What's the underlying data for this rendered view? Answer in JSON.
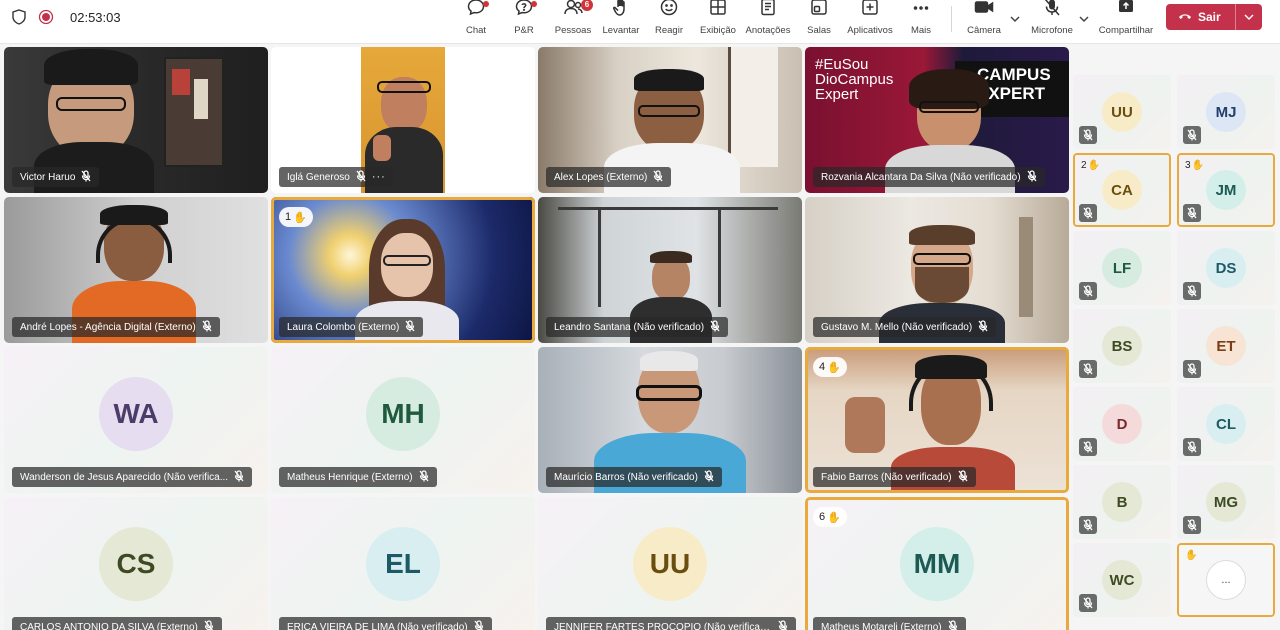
{
  "timer": "02:53:03",
  "toolbar": [
    {
      "label": "Chat",
      "icon": "chat-icon"
    },
    {
      "label": "P&R",
      "icon": "qa-icon"
    },
    {
      "label": "Pessoas",
      "icon": "people-icon",
      "badge": "6"
    },
    {
      "label": "Levantar",
      "icon": "hand-icon"
    },
    {
      "label": "Reagir",
      "icon": "emoji-icon"
    },
    {
      "label": "Exibição",
      "icon": "view-icon"
    },
    {
      "label": "Anotações",
      "icon": "notes-icon"
    },
    {
      "label": "Salas",
      "icon": "rooms-icon"
    },
    {
      "label": "Aplicativos",
      "icon": "apps-icon"
    },
    {
      "label": "Mais",
      "icon": "more-icon"
    },
    {
      "label": "Câmera",
      "icon": "camera-icon"
    },
    {
      "label": "Microfone",
      "icon": "mic-off-icon"
    },
    {
      "label": "Compartilhar",
      "icon": "share-icon"
    }
  ],
  "leave": {
    "label": "Sair"
  },
  "colors": {
    "accent": "#e8a93d",
    "leave": "#c4314b"
  },
  "tiles": [
    {
      "name": "Victor Haruo",
      "hand": null
    },
    {
      "name": "Iglá Generoso",
      "hand": null
    },
    {
      "name": "Alex Lopes (Externo)",
      "hand": null
    },
    {
      "name": "Rozvania Alcantara Da Silva (Não verificado)",
      "hand": null,
      "sign": "#EuSou DioCampus Expert",
      "banner": "CAMPUS EXPERT"
    },
    {
      "name": "André Lopes - Agência Digital (Externo)",
      "hand": null
    },
    {
      "name": "Laura Colombo (Externo)",
      "hand": "1"
    },
    {
      "name": "Leandro Santana (Não verificado)",
      "hand": null
    },
    {
      "name": "Gustavo M. Mello (Não verificado)",
      "hand": null
    },
    {
      "name": "Wanderson de Jesus Aparecido (Não verifica...",
      "hand": null,
      "initials": "WA"
    },
    {
      "name": "Matheus Henrique (Externo)",
      "hand": null,
      "initials": "MH"
    },
    {
      "name": "Maurício Barros (Não verificado)",
      "hand": null
    },
    {
      "name": "Fabio Barros (Não verificado)",
      "hand": "4"
    },
    {
      "name": "CARLOS ANTONIO DA SILVA (Externo)",
      "hand": null,
      "initials": "CS"
    },
    {
      "name": "ERICA VIEIRA DE LIMA (Não verificado)",
      "hand": null,
      "initials": "EL"
    },
    {
      "name": "JENNIFER FARTES PROCOPIO (Não verificado)",
      "hand": null,
      "initials": "UU"
    },
    {
      "name": "Matheus Motareli (Externo)",
      "hand": "6",
      "initials": "MM"
    }
  ],
  "side": [
    {
      "initials": "UU",
      "hand": null
    },
    {
      "initials": "MJ",
      "hand": null
    },
    {
      "initials": "CA",
      "hand": "2"
    },
    {
      "initials": "JM",
      "hand": "3"
    },
    {
      "initials": "LF",
      "hand": null
    },
    {
      "initials": "DS",
      "hand": null
    },
    {
      "initials": "BS",
      "hand": null
    },
    {
      "initials": "ET",
      "hand": null
    },
    {
      "initials": "D",
      "hand": null
    },
    {
      "initials": "CL",
      "hand": null
    },
    {
      "initials": "B",
      "hand": null
    },
    {
      "initials": "MG",
      "hand": null
    },
    {
      "initials": "WC",
      "hand": null
    },
    {
      "initials": "...",
      "hand": ""
    }
  ]
}
